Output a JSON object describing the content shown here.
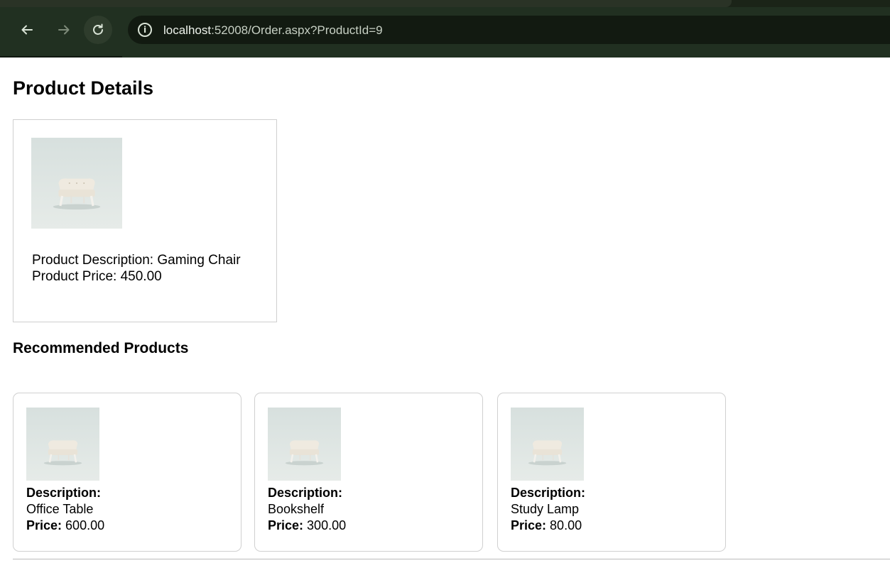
{
  "browser": {
    "url_host": "localhost",
    "url_rest": ":52008/Order.aspx?ProductId=9"
  },
  "page": {
    "title": "Product Details"
  },
  "product": {
    "description_line": "Product Description: Gaming Chair",
    "price_line": "Product Price: 450.00"
  },
  "recommended": {
    "title": "Recommended Products",
    "description_label": "Description:",
    "price_label": "Price:",
    "items": [
      {
        "description": "Office Table",
        "price": "600.00"
      },
      {
        "description": "Bookshelf",
        "price": "300.00"
      },
      {
        "description": "Study Lamp",
        "price": "80.00"
      }
    ]
  },
  "colors": {
    "toolbar_bg": "#213021",
    "omnibox_bg": "#121a11"
  },
  "icons": {
    "back": "arrow-left-icon",
    "forward": "arrow-right-icon",
    "reload": "reload-icon",
    "site_info": "info-icon"
  }
}
